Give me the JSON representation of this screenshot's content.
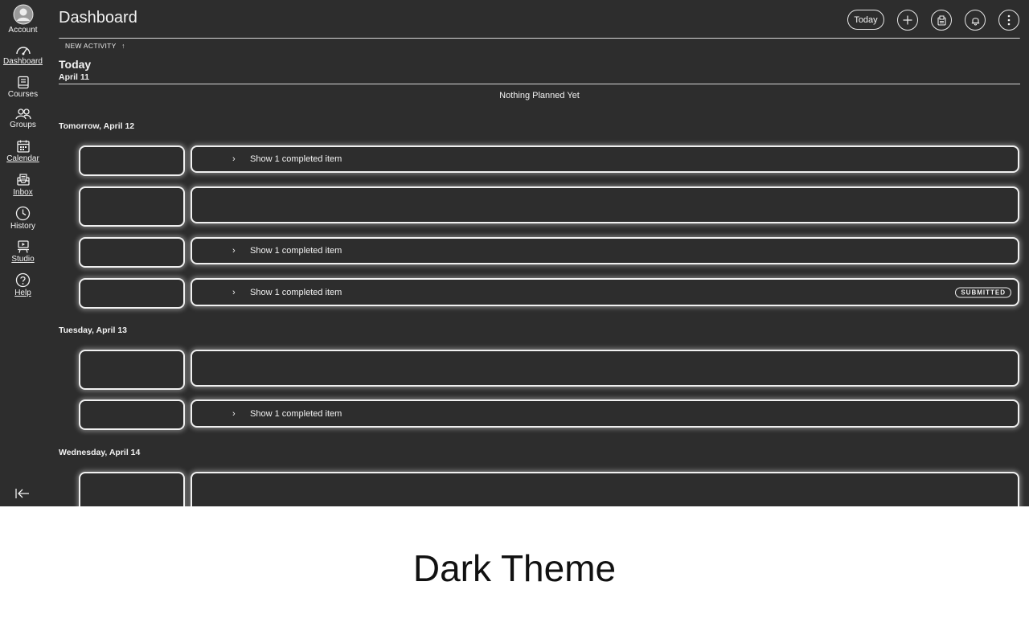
{
  "sidebar": {
    "items": [
      {
        "label": "Account",
        "icon": "account-icon"
      },
      {
        "label": "Dashboard",
        "icon": "dashboard-icon"
      },
      {
        "label": "Courses",
        "icon": "courses-icon"
      },
      {
        "label": "Groups",
        "icon": "groups-icon"
      },
      {
        "label": "Calendar",
        "icon": "calendar-icon"
      },
      {
        "label": "Inbox",
        "icon": "inbox-icon"
      },
      {
        "label": "History",
        "icon": "history-icon"
      },
      {
        "label": "Studio",
        "icon": "studio-icon"
      },
      {
        "label": "Help",
        "icon": "help-icon"
      }
    ]
  },
  "header": {
    "title": "Dashboard",
    "today_label": "Today",
    "new_activity": "NEW ACTIVITY",
    "new_activity_arrow": "↑"
  },
  "today": {
    "heading": "Today",
    "date": "April 11",
    "empty_text": "Nothing Planned Yet"
  },
  "days": [
    {
      "heading": "Tomorrow, April 12"
    },
    {
      "heading": "Tuesday, April 13"
    },
    {
      "heading": "Wednesday, April 14"
    }
  ],
  "items": {
    "completed_text": "Show 1 completed item",
    "chevron": "›",
    "submitted_badge": "SUBMITTED"
  },
  "caption": "Dark Theme",
  "colors": {
    "background": "#2d2d2d",
    "foreground": "#f2f2f2",
    "caption_bg": "#ffffff"
  }
}
